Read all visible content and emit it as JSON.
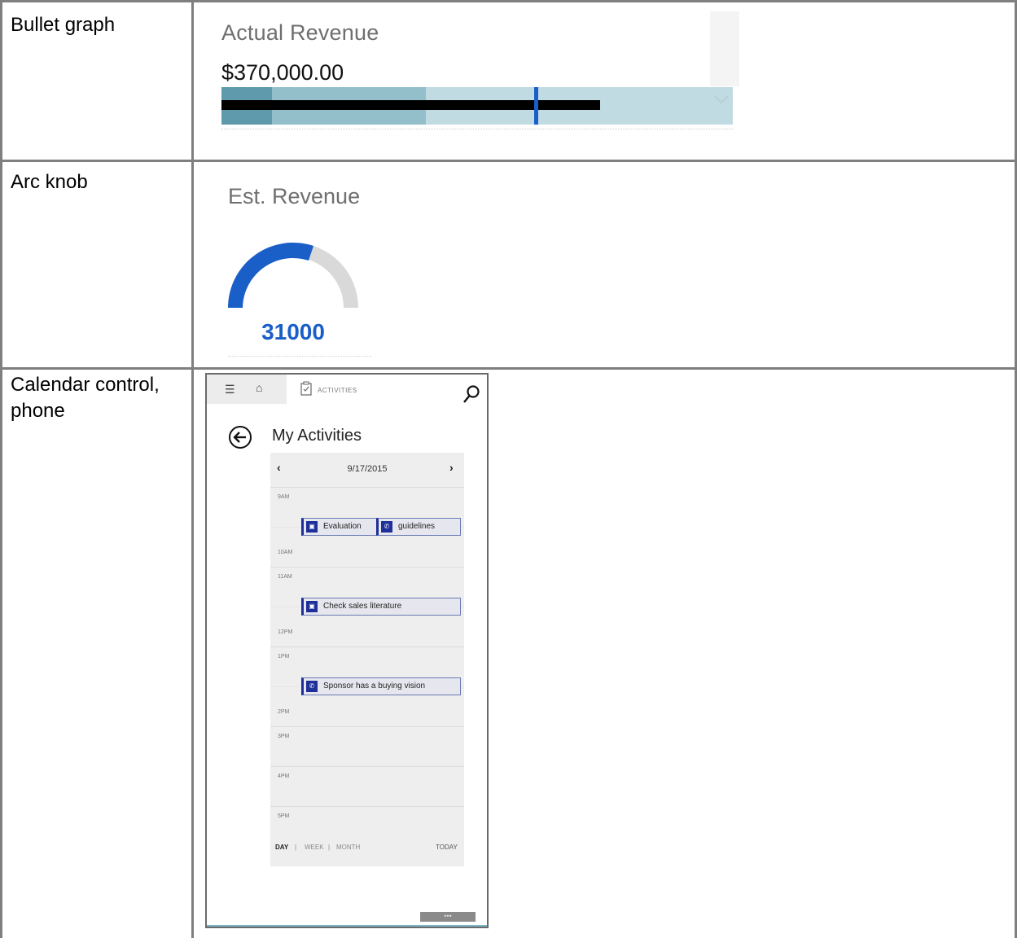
{
  "rows": [
    {
      "label": "Bullet graph"
    },
    {
      "label": "Arc knob"
    },
    {
      "label": "Calendar control,\nphone"
    }
  ],
  "bullet_graph": {
    "title": "Actual Revenue",
    "value": "$370,000.00",
    "colors": {
      "band_dark": "#5e9aab",
      "band_mid": "#93bfcb",
      "band_light": "#c1dbe2",
      "bar": "#000000",
      "target": "#1a5fc8"
    }
  },
  "arc_knob": {
    "title": "Est. Revenue",
    "value": "31000",
    "colors": {
      "fill": "#1a5fc8",
      "track": "#d9d9d9"
    }
  },
  "phone": {
    "header": {
      "activities_label": "ACTIVITIES"
    },
    "title": "My Activities",
    "calendar": {
      "date": "9/17/2015",
      "times": [
        "9AM",
        "10AM",
        "11AM",
        "12PM",
        "1PM",
        "2PM",
        "3PM",
        "4PM",
        "5PM"
      ],
      "events": [
        "Evaluation",
        "guidelines",
        "Check sales literature",
        "Sponsor has a buying vision"
      ],
      "views": {
        "day": "DAY",
        "week": "WEEK",
        "month": "MONTH",
        "sep": "|",
        "today": "TODAY"
      }
    },
    "more": "•••"
  }
}
